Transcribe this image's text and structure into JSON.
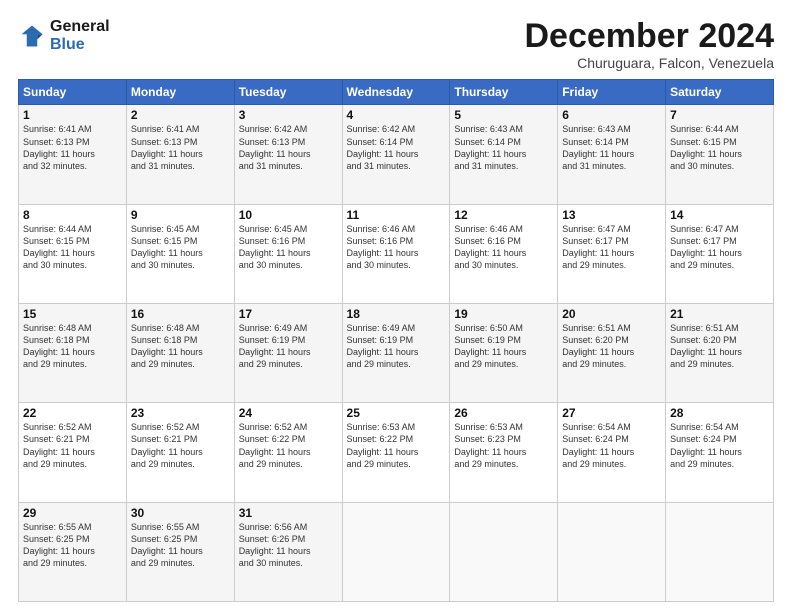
{
  "header": {
    "logo_line1": "General",
    "logo_line2": "Blue",
    "month": "December 2024",
    "location": "Churuguara, Falcon, Venezuela"
  },
  "weekdays": [
    "Sunday",
    "Monday",
    "Tuesday",
    "Wednesday",
    "Thursday",
    "Friday",
    "Saturday"
  ],
  "weeks": [
    [
      {
        "day": "1",
        "info": "Sunrise: 6:41 AM\nSunset: 6:13 PM\nDaylight: 11 hours\nand 32 minutes."
      },
      {
        "day": "2",
        "info": "Sunrise: 6:41 AM\nSunset: 6:13 PM\nDaylight: 11 hours\nand 31 minutes."
      },
      {
        "day": "3",
        "info": "Sunrise: 6:42 AM\nSunset: 6:13 PM\nDaylight: 11 hours\nand 31 minutes."
      },
      {
        "day": "4",
        "info": "Sunrise: 6:42 AM\nSunset: 6:14 PM\nDaylight: 11 hours\nand 31 minutes."
      },
      {
        "day": "5",
        "info": "Sunrise: 6:43 AM\nSunset: 6:14 PM\nDaylight: 11 hours\nand 31 minutes."
      },
      {
        "day": "6",
        "info": "Sunrise: 6:43 AM\nSunset: 6:14 PM\nDaylight: 11 hours\nand 31 minutes."
      },
      {
        "day": "7",
        "info": "Sunrise: 6:44 AM\nSunset: 6:15 PM\nDaylight: 11 hours\nand 30 minutes."
      }
    ],
    [
      {
        "day": "8",
        "info": "Sunrise: 6:44 AM\nSunset: 6:15 PM\nDaylight: 11 hours\nand 30 minutes."
      },
      {
        "day": "9",
        "info": "Sunrise: 6:45 AM\nSunset: 6:15 PM\nDaylight: 11 hours\nand 30 minutes."
      },
      {
        "day": "10",
        "info": "Sunrise: 6:45 AM\nSunset: 6:16 PM\nDaylight: 11 hours\nand 30 minutes."
      },
      {
        "day": "11",
        "info": "Sunrise: 6:46 AM\nSunset: 6:16 PM\nDaylight: 11 hours\nand 30 minutes."
      },
      {
        "day": "12",
        "info": "Sunrise: 6:46 AM\nSunset: 6:16 PM\nDaylight: 11 hours\nand 30 minutes."
      },
      {
        "day": "13",
        "info": "Sunrise: 6:47 AM\nSunset: 6:17 PM\nDaylight: 11 hours\nand 29 minutes."
      },
      {
        "day": "14",
        "info": "Sunrise: 6:47 AM\nSunset: 6:17 PM\nDaylight: 11 hours\nand 29 minutes."
      }
    ],
    [
      {
        "day": "15",
        "info": "Sunrise: 6:48 AM\nSunset: 6:18 PM\nDaylight: 11 hours\nand 29 minutes."
      },
      {
        "day": "16",
        "info": "Sunrise: 6:48 AM\nSunset: 6:18 PM\nDaylight: 11 hours\nand 29 minutes."
      },
      {
        "day": "17",
        "info": "Sunrise: 6:49 AM\nSunset: 6:19 PM\nDaylight: 11 hours\nand 29 minutes."
      },
      {
        "day": "18",
        "info": "Sunrise: 6:49 AM\nSunset: 6:19 PM\nDaylight: 11 hours\nand 29 minutes."
      },
      {
        "day": "19",
        "info": "Sunrise: 6:50 AM\nSunset: 6:19 PM\nDaylight: 11 hours\nand 29 minutes."
      },
      {
        "day": "20",
        "info": "Sunrise: 6:51 AM\nSunset: 6:20 PM\nDaylight: 11 hours\nand 29 minutes."
      },
      {
        "day": "21",
        "info": "Sunrise: 6:51 AM\nSunset: 6:20 PM\nDaylight: 11 hours\nand 29 minutes."
      }
    ],
    [
      {
        "day": "22",
        "info": "Sunrise: 6:52 AM\nSunset: 6:21 PM\nDaylight: 11 hours\nand 29 minutes."
      },
      {
        "day": "23",
        "info": "Sunrise: 6:52 AM\nSunset: 6:21 PM\nDaylight: 11 hours\nand 29 minutes."
      },
      {
        "day": "24",
        "info": "Sunrise: 6:52 AM\nSunset: 6:22 PM\nDaylight: 11 hours\nand 29 minutes."
      },
      {
        "day": "25",
        "info": "Sunrise: 6:53 AM\nSunset: 6:22 PM\nDaylight: 11 hours\nand 29 minutes."
      },
      {
        "day": "26",
        "info": "Sunrise: 6:53 AM\nSunset: 6:23 PM\nDaylight: 11 hours\nand 29 minutes."
      },
      {
        "day": "27",
        "info": "Sunrise: 6:54 AM\nSunset: 6:24 PM\nDaylight: 11 hours\nand 29 minutes."
      },
      {
        "day": "28",
        "info": "Sunrise: 6:54 AM\nSunset: 6:24 PM\nDaylight: 11 hours\nand 29 minutes."
      }
    ],
    [
      {
        "day": "29",
        "info": "Sunrise: 6:55 AM\nSunset: 6:25 PM\nDaylight: 11 hours\nand 29 minutes."
      },
      {
        "day": "30",
        "info": "Sunrise: 6:55 AM\nSunset: 6:25 PM\nDaylight: 11 hours\nand 29 minutes."
      },
      {
        "day": "31",
        "info": "Sunrise: 6:56 AM\nSunset: 6:26 PM\nDaylight: 11 hours\nand 30 minutes."
      },
      {
        "day": "",
        "info": ""
      },
      {
        "day": "",
        "info": ""
      },
      {
        "day": "",
        "info": ""
      },
      {
        "day": "",
        "info": ""
      }
    ]
  ]
}
